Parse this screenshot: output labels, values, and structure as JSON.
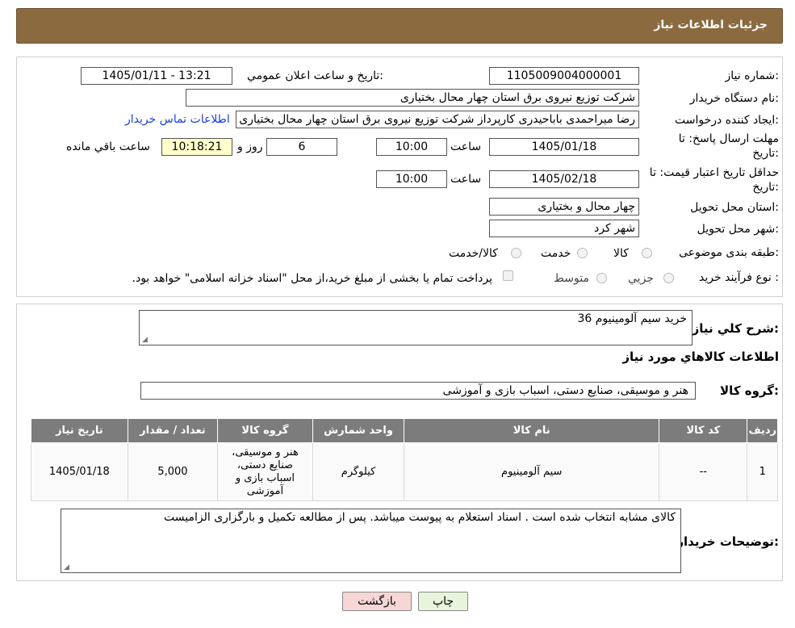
{
  "header": {
    "title": "جزئيات اطلاعات نياز"
  },
  "form": {
    "need_number_label": "شماره نياز:",
    "need_number": "1105009004000001",
    "announce_label": "تاريخ و ساعت اعلان عمومي:",
    "announce_value": "1405/01/11 - 13:21",
    "buyer_org_label": "نام دستگاه خريدار:",
    "buyer_org": "شركت توزيع نيروی برق استان چهار محال بختياری",
    "requester_label": "ايجاد کننده درخواست:",
    "requester": "رضا ميراحمدی باباحيدری کارپرداز شركت توزيع نيروی برق استان چهار محال بختياری",
    "contact_link": "اطلاعات تماس خريدار",
    "deadline_label": "مهلت ارسال پاسخ: تا",
    "deadline_label2": "تاريخ:",
    "deadline_date": "1405/01/18",
    "time_label": "ساعت",
    "deadline_time": "10:00",
    "days_value": "6",
    "days_label": "روز و",
    "remaining_time": "10:18:21",
    "remaining_label": "ساعت باقي مانده",
    "price_valid_label": "حداقل تاريخ اعتبار قيمت: تا",
    "price_valid_label2": "تاريخ:",
    "price_valid_date": "1405/02/18",
    "price_valid_time": "10:00",
    "province_label": "استان محل تحويل:",
    "province": "چهار محال و بختياری",
    "city_label": "شهر محل تحويل:",
    "city": "شهر کرد",
    "category_label": "طبقه بندی موضوعی:",
    "category_options": [
      "کالا",
      "خدمت",
      "کالا/خدمت"
    ],
    "process_label": "نوع فرآيند خريد :",
    "process_options": [
      "جزيي",
      "متوسط"
    ],
    "payment_note": "پرداخت تمام يا بخشی از مبلغ خريد،از محل \"اسناد خزانه اسلامی\" خواهد بود."
  },
  "details": {
    "summary_label": "شرح كلي نياز:",
    "summary_value": "خريد سيم آلومينيوم 36",
    "goods_info_title": "اطلاعات کالاهاي مورد نياز",
    "group_label": "گروه کالا:",
    "group_value": "هنر و موسيقی، صنايع دستی، اسباب بازی و آموزشی",
    "table": {
      "headers": [
        "رديف",
        "کد کالا",
        "نام کالا",
        "واحد شمارش",
        "گروه کالا",
        "تعداد / مقدار",
        "تاريخ نياز"
      ],
      "rows": [
        [
          "1",
          "--",
          "سيم آلومينيوم",
          "کيلوگرم",
          "هنر و موسيقی، صنايع دستی، اسباب بازی و آموزشی",
          "5,000",
          "1405/01/18"
        ]
      ]
    },
    "buyer_notes_label": "توضيحات خريدار:",
    "buyer_notes": "کالای مشابه انتخاب شده است . اسناد استعلام به پيوست ميباشد. پس از مطالعه تکميل و بارگزاری الزاميست"
  },
  "buttons": {
    "print": "چاپ",
    "back": "بازگشت"
  },
  "colors": {
    "header_bg": "#8b6a3f",
    "table_header_bg": "#7c7c7c",
    "back_btn": "#f7d6d6",
    "print_btn": "#e7f5dc"
  }
}
